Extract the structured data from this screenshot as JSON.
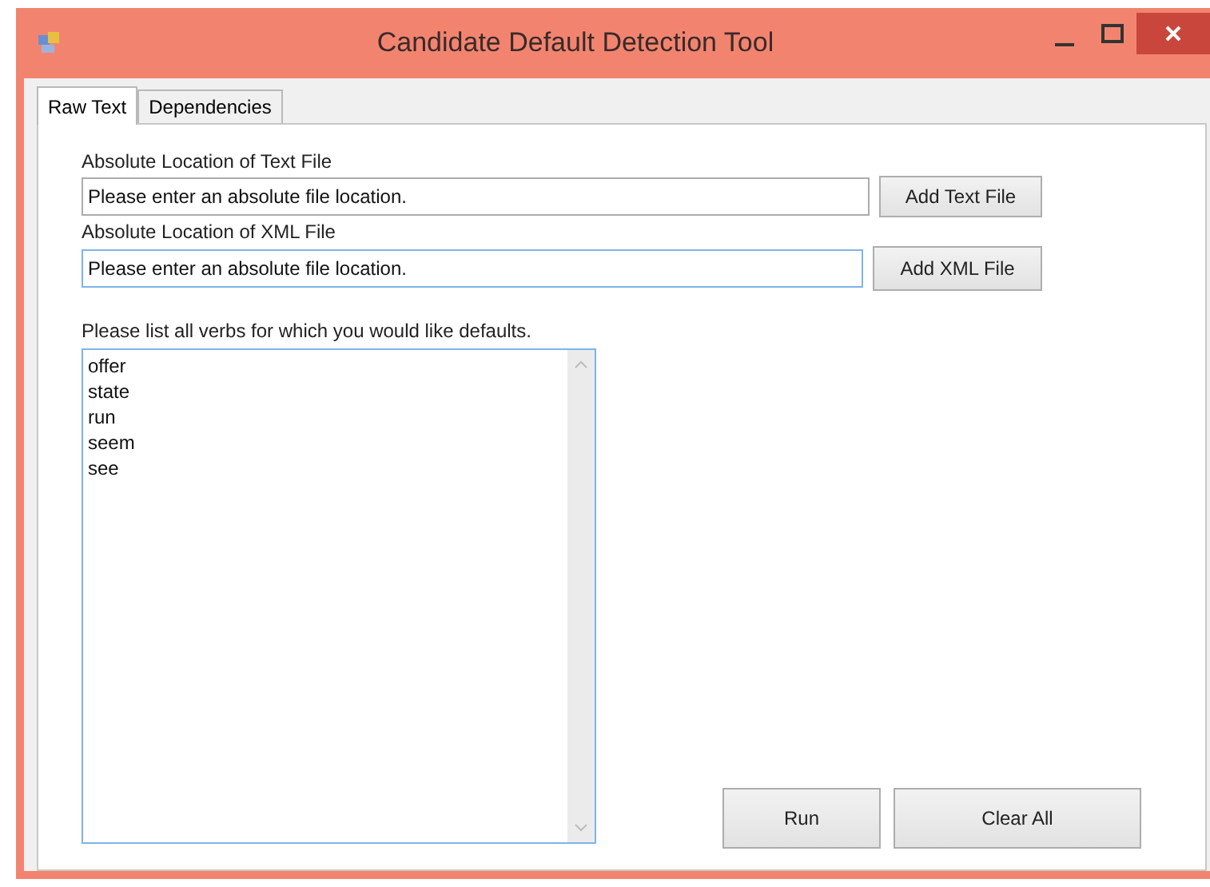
{
  "window": {
    "title": "Candidate Default Detection Tool"
  },
  "tabs": [
    {
      "label": "Raw Text",
      "selected": true
    },
    {
      "label": "Dependencies",
      "selected": false
    }
  ],
  "text_file": {
    "label": "Absolute Location of Text File",
    "value": "Please enter an absolute file location.",
    "focused": false,
    "button": "Add Text File"
  },
  "xml_file": {
    "label": "Absolute Location of XML File",
    "value": "Please enter an absolute file location.",
    "focused": true,
    "button": "Add XML File"
  },
  "verbs": {
    "label": "Please list all verbs for which you would like defaults.",
    "lines": [
      "offer",
      "state",
      "run",
      "seem",
      "see"
    ]
  },
  "buttons": [
    "Run",
    "Clear All"
  ]
}
